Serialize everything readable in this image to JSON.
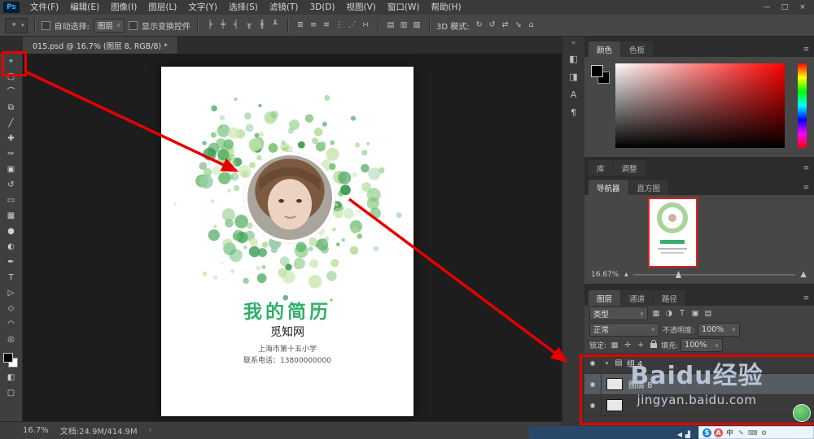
{
  "titlebar": {
    "logo": "Ps",
    "menus": [
      "文件(F)",
      "编辑(E)",
      "图像(I)",
      "图层(L)",
      "文字(Y)",
      "选择(S)",
      "滤镜(T)",
      "3D(D)",
      "视图(V)",
      "窗口(W)",
      "帮助(H)"
    ],
    "window_controls": [
      "—",
      "□",
      "×"
    ]
  },
  "options": {
    "tool_icon": "⌖",
    "auto_select_label": "自动选择:",
    "auto_select_value": "图层",
    "show_transform_label": "显示变换控件",
    "align_icons": [
      {
        "name": "align-left-icon",
        "glyph": "╞"
      },
      {
        "name": "align-center-h-icon",
        "glyph": "╪"
      },
      {
        "name": "align-right-icon",
        "glyph": "╡"
      },
      {
        "name": "align-top-icon",
        "glyph": "╥"
      },
      {
        "name": "align-middle-icon",
        "glyph": "╫"
      },
      {
        "name": "align-bottom-icon",
        "glyph": "╨"
      }
    ],
    "distribute_icons": [
      {
        "name": "distribute-top-icon",
        "glyph": "≣"
      },
      {
        "name": "distribute-middle-icon",
        "glyph": "≡"
      },
      {
        "name": "distribute-bottom-icon",
        "glyph": "≋"
      },
      {
        "name": "distribute-left-icon",
        "glyph": "⋮"
      },
      {
        "name": "distribute-center-icon",
        "glyph": "⋰"
      },
      {
        "name": "distribute-right-icon",
        "glyph": "∺"
      }
    ],
    "extra_icons": [
      {
        "name": "auto-align-icon",
        "glyph": "▤"
      },
      {
        "name": "warp-mode-icon",
        "glyph": "▥"
      },
      {
        "name": "workspace-icon",
        "glyph": "▧"
      }
    ],
    "mode_3d_label": "3D 模式:",
    "mode_3d_icons": [
      {
        "name": "3d-rotate-icon",
        "glyph": "↻"
      },
      {
        "name": "3d-roll-icon",
        "glyph": "↺"
      },
      {
        "name": "3d-drag-icon",
        "glyph": "⇄"
      },
      {
        "name": "3d-slide-icon",
        "glyph": "⇘"
      },
      {
        "name": "3d-scale-icon",
        "glyph": "⌂"
      }
    ]
  },
  "doc_tab": "015.psd @ 16.7% (图层 8, RGB/8) *",
  "toolbar": {
    "tools": [
      {
        "name": "move-tool",
        "glyph": "⌖"
      },
      {
        "name": "rect-marquee-tool",
        "glyph": "▢"
      },
      {
        "name": "lasso-tool",
        "glyph": "⌒"
      },
      {
        "name": "crop-tool",
        "glyph": "⧉"
      },
      {
        "name": "eyedropper-tool",
        "glyph": "╱"
      },
      {
        "name": "spot-healing-tool",
        "glyph": "✚"
      },
      {
        "name": "brush-tool",
        "glyph": "✑"
      },
      {
        "name": "clone-stamp-tool",
        "glyph": "▣"
      },
      {
        "name": "history-brush-tool",
        "glyph": "↺"
      },
      {
        "name": "eraser-tool",
        "glyph": "▭"
      },
      {
        "name": "gradient-tool",
        "glyph": "▦"
      },
      {
        "name": "blur-tool",
        "glyph": "●"
      },
      {
        "name": "dodge-tool",
        "glyph": "◐"
      },
      {
        "name": "pen-tool",
        "glyph": "✒"
      },
      {
        "name": "type-tool",
        "glyph": "T"
      },
      {
        "name": "path-select-tool",
        "glyph": "▷"
      },
      {
        "name": "shape-tool",
        "glyph": "◇"
      },
      {
        "name": "hand-tool",
        "glyph": "◠"
      },
      {
        "name": "zoom-tool",
        "glyph": "◎"
      }
    ],
    "quick_mask": "◧",
    "screen_mode": "▢"
  },
  "artboard": {
    "title": "我的简历",
    "org": "觅知网",
    "line1": "上海市第十五小学",
    "line2": "联系电话：13800000000",
    "title_color": "#2fae6a",
    "wreath_colors": [
      "#86c97c",
      "#a8d98e",
      "#5bb36b",
      "#cfe8b5",
      "#93d0a4",
      "#6fbe74",
      "#b9e0a0",
      "#3f9e57"
    ]
  },
  "dock": {
    "icons": [
      {
        "name": "properties-panel-icon",
        "glyph": "◧"
      },
      {
        "name": "info-panel-icon",
        "glyph": "◨"
      },
      {
        "name": "character-panel-icon",
        "glyph": "A"
      },
      {
        "name": "paragraph-panel-icon",
        "glyph": "¶"
      }
    ]
  },
  "panels": {
    "color": {
      "tabs": [
        "颜色",
        "色板"
      ]
    },
    "library": {
      "tabs": [
        "库",
        "调整"
      ]
    },
    "navigator": {
      "tabs": [
        "导航器",
        "直方图"
      ],
      "zoom": "16.67%"
    },
    "layers": {
      "tabs": [
        "图层",
        "通道",
        "路径"
      ],
      "filter_label": "类型",
      "filter_icons": [
        {
          "name": "filter-pixel-layers-icon",
          "glyph": "▦"
        },
        {
          "name": "filter-adjustment-layers-icon",
          "glyph": "◑"
        },
        {
          "name": "filter-text-layers-icon",
          "glyph": "T"
        },
        {
          "name": "filter-shape-layers-icon",
          "glyph": "▣"
        },
        {
          "name": "filter-smart-objects-icon",
          "glyph": "▤"
        }
      ],
      "blend_mode": "正常",
      "opacity_label": "不透明度:",
      "opacity_value": "100%",
      "lock_label": "锁定:",
      "lock_icons": [
        {
          "name": "lock-transparency-icon",
          "glyph": "▦"
        },
        {
          "name": "lock-paint-icon",
          "glyph": "✛"
        },
        {
          "name": "lock-move-icon",
          "glyph": "+"
        }
      ],
      "fill_label": "填充:",
      "fill_value": "100%",
      "rows": [
        {
          "name": "组 4",
          "type": "group",
          "selected": false
        },
        {
          "name": "图层 8",
          "type": "layer",
          "selected": true
        },
        {
          "name": "",
          "type": "layer",
          "selected": false
        }
      ]
    }
  },
  "status": {
    "zoom": "16.7%",
    "doc": "文档:24.9M/414.9M"
  },
  "watermark": {
    "brand": "Baidu",
    "brand2": "经验",
    "url": "jingyan.baidu.com"
  },
  "taskbar": {
    "icons": [
      {
        "name": "sogou-icon",
        "glyph": "S",
        "bg": "#1f86e0",
        "fg": "#ffffff"
      },
      {
        "name": "input-mode-icon",
        "glyph": "A",
        "bg": "#e8554d",
        "fg": "#ffffff"
      },
      {
        "name": "chinese-input-icon",
        "glyph": "中",
        "bg": "",
        "fg": "#555555"
      },
      {
        "name": "handwriting-icon",
        "glyph": "✎",
        "bg": "",
        "fg": "#666666"
      },
      {
        "name": "keyboard-icon",
        "glyph": "⌨",
        "bg": "",
        "fg": "#666666"
      },
      {
        "name": "input-settings-icon",
        "glyph": "⚙",
        "bg": "",
        "fg": "#666666"
      }
    ],
    "tray_icons": [
      {
        "name": "volume-icon",
        "glyph": "◀",
        "bg": "",
        "fg": "#d7e4f2"
      },
      {
        "name": "network-icon",
        "glyph": "▟",
        "bg": "",
        "fg": "#d7e4f2"
      }
    ]
  },
  "icons": {
    "eye": "◉",
    "caret": "▾",
    "chevron": "∨",
    "folder": "▤",
    "menu": "≡",
    "expand": "«",
    "arrow_right": "›",
    "slider_small": "▴",
    "slider_large": "▲"
  }
}
